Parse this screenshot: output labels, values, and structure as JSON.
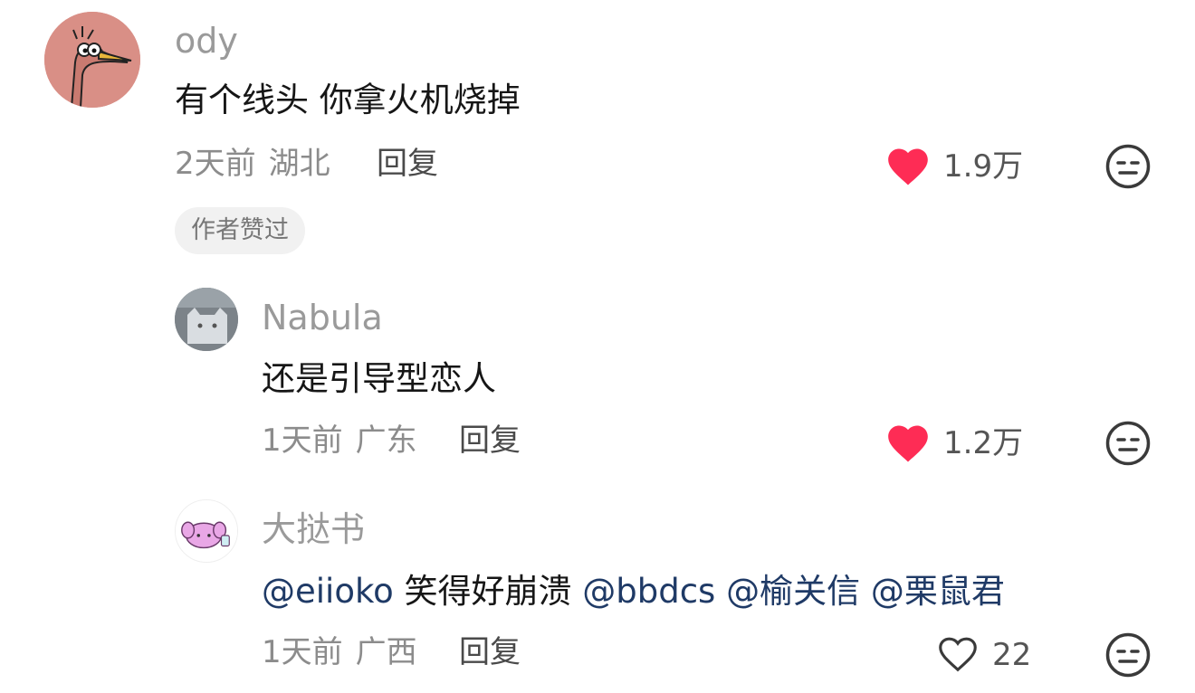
{
  "comments": [
    {
      "username": "ody",
      "content": "有个线头 你拿火机烧掉",
      "time": "2天前",
      "location": "湖北",
      "reply_label": "回复",
      "likes": "1.9万",
      "liked": true,
      "badge": "作者赞过"
    },
    {
      "username": "Nabula",
      "content": "还是引导型恋人",
      "time": "1天前",
      "location": "广东",
      "reply_label": "回复",
      "likes": "1.2万",
      "liked": true
    },
    {
      "username": "大挞书",
      "content_parts": [
        {
          "text": "@eiioko",
          "mention": true
        },
        {
          "text": " 笑得好崩溃 ",
          "mention": false
        },
        {
          "text": "@bbdcs",
          "mention": true
        },
        {
          "text": " ",
          "mention": false
        },
        {
          "text": "@榆关信",
          "mention": true
        },
        {
          "text": " ",
          "mention": false
        },
        {
          "text": "@栗鼠君",
          "mention": true
        }
      ],
      "time": "1天前",
      "location": "广西",
      "reply_label": "回复",
      "likes": "22",
      "liked": false
    }
  ],
  "icons": {
    "like_filled": "heart-filled-icon",
    "like_outline": "heart-outline-icon",
    "dislike": "neutral-face-icon"
  },
  "colors": {
    "like_red": "#fe2c55",
    "mention_blue": "#1f3a66",
    "meta_gray": "#8c8c8c",
    "username_gray": "#9a9a9a"
  }
}
